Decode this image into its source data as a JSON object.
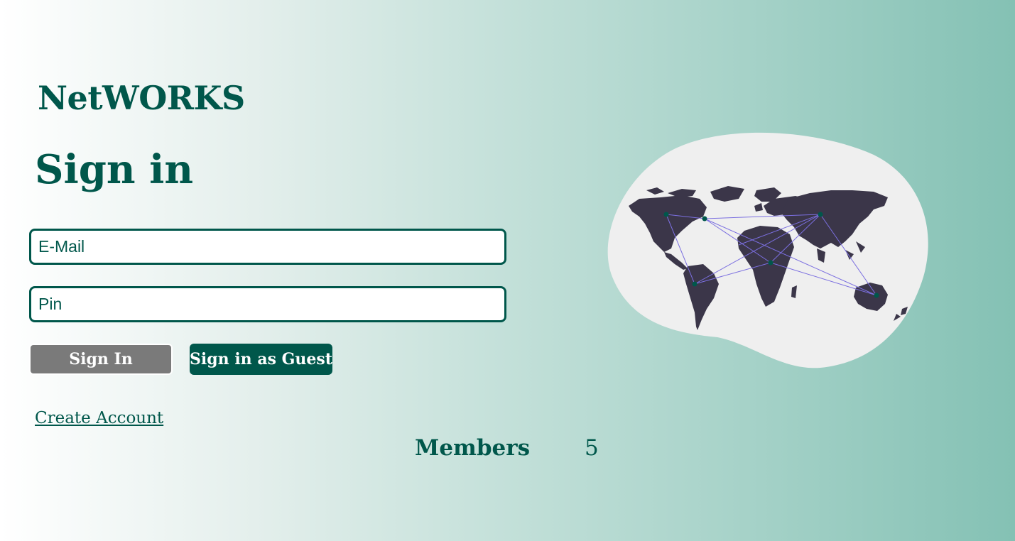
{
  "brand": {
    "name": "NetWORKS"
  },
  "form": {
    "title": "Sign in",
    "email": {
      "placeholder": "E-Mail",
      "value": ""
    },
    "pin": {
      "placeholder": "Pin",
      "value": ""
    },
    "signin_button": "Sign In",
    "guest_button": "Sign in as Guest",
    "create_account_link": "Create Account"
  },
  "stats": {
    "members_label": "Members",
    "members_count": "5"
  },
  "illustration": {
    "icon": "world-network-map-icon"
  },
  "colors": {
    "primary": "#00574b",
    "button_disabled": "#7a7a7a",
    "gradient_start": "#ffffff",
    "gradient_end": "#84c1b4",
    "blob": "#efefef",
    "continents": "#3b3649",
    "network_lines": "#7b6fe0"
  }
}
